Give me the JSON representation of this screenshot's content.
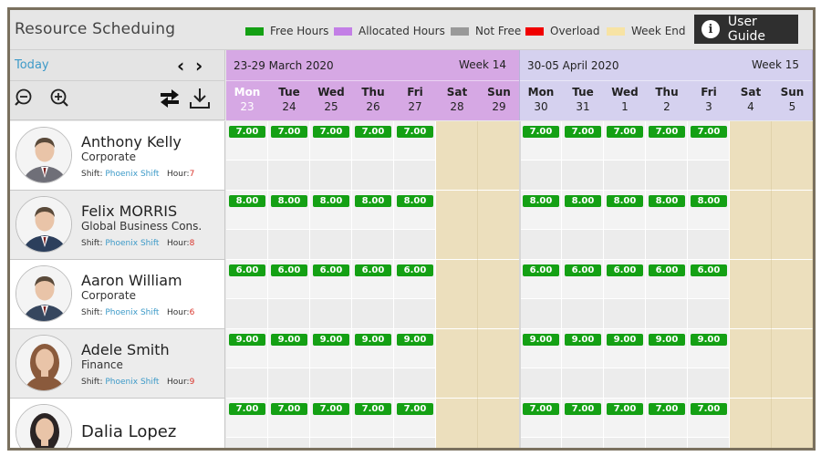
{
  "header": {
    "title": "Resource Scheduing",
    "legend": [
      {
        "label": "Free Hours",
        "color": "#14a014"
      },
      {
        "label": "Allocated Hours",
        "color": "#c37fe6"
      },
      {
        "label": "Not Free",
        "color": "#999999"
      },
      {
        "label": "Overload",
        "color": "#f00000"
      },
      {
        "label": "Week End",
        "color": "#f7e3a4"
      }
    ],
    "guide_button": {
      "icon": "info-icon",
      "label": "User Guide"
    }
  },
  "controls": {
    "today_label": "Today",
    "prev_icon": "chevron-left-icon",
    "next_icon": "chevron-right-icon",
    "zoom_out_icon": "zoom-out-icon",
    "zoom_in_icon": "zoom-in-icon",
    "swap_icon": "swap-arrows-icon",
    "download_icon": "download-icon"
  },
  "weeks": [
    {
      "range": "23-29 March 2020",
      "week_label": "Week 14",
      "header_color": "#d6a8e4",
      "days": [
        {
          "name": "Mon",
          "date": "23",
          "weekend": false,
          "today": true
        },
        {
          "name": "Tue",
          "date": "24",
          "weekend": false,
          "today": false
        },
        {
          "name": "Wed",
          "date": "25",
          "weekend": false,
          "today": false
        },
        {
          "name": "Thu",
          "date": "26",
          "weekend": false,
          "today": false
        },
        {
          "name": "Fri",
          "date": "27",
          "weekend": false,
          "today": false
        },
        {
          "name": "Sat",
          "date": "28",
          "weekend": true,
          "today": false
        },
        {
          "name": "Sun",
          "date": "29",
          "weekend": true,
          "today": false
        }
      ]
    },
    {
      "range": "30-05 April 2020",
      "week_label": "Week 15",
      "header_color": "#d5d1ef",
      "days": [
        {
          "name": "Mon",
          "date": "30",
          "weekend": false,
          "today": false
        },
        {
          "name": "Tue",
          "date": "31",
          "weekend": false,
          "today": false
        },
        {
          "name": "Wed",
          "date": "1",
          "weekend": false,
          "today": false
        },
        {
          "name": "Thu",
          "date": "2",
          "weekend": false,
          "today": false
        },
        {
          "name": "Fri",
          "date": "3",
          "weekend": false,
          "today": false
        },
        {
          "name": "Sat",
          "date": "4",
          "weekend": true,
          "today": false
        },
        {
          "name": "Sun",
          "date": "5",
          "weekend": true,
          "today": false
        }
      ]
    }
  ],
  "resources": [
    {
      "name": "Anthony Kelly",
      "dept": "Corporate",
      "shift_label": "Shift:",
      "shift": "Phoenix Shift",
      "hour_label": "Hour:",
      "hour": "7",
      "free_hours": "7.00",
      "avatar": "avatar-male-icon",
      "avatar_bg": "#6f6f78"
    },
    {
      "name": "Felix MORRIS",
      "dept": "Global Business Cons.",
      "shift_label": "Shift:",
      "shift": "Phoenix Shift",
      "hour_label": "Hour:",
      "hour": "8",
      "free_hours": "8.00",
      "avatar": "avatar-male-icon",
      "avatar_bg": "#2c3f5c"
    },
    {
      "name": "Aaron William",
      "dept": "Corporate",
      "shift_label": "Shift:",
      "shift": "Phoenix Shift",
      "hour_label": "Hour:",
      "hour": "6",
      "free_hours": "6.00",
      "avatar": "avatar-male-icon",
      "avatar_bg": "#36465e"
    },
    {
      "name": "Adele Smith",
      "dept": "Finance",
      "shift_label": "Shift:",
      "shift": "Phoenix Shift",
      "hour_label": "Hour:",
      "hour": "9",
      "free_hours": "9.00",
      "avatar": "avatar-female-icon",
      "avatar_bg": "#8a5a3c"
    },
    {
      "name": "Dalia Lopez",
      "dept": "",
      "shift_label": "",
      "shift": "",
      "hour_label": "",
      "hour": "",
      "free_hours": "7.00",
      "avatar": "avatar-female-icon",
      "avatar_bg": "#2b2424"
    }
  ]
}
